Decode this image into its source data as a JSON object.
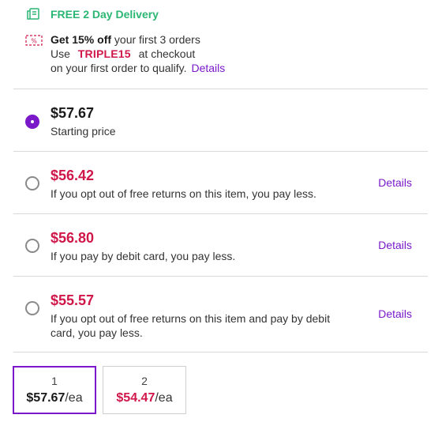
{
  "delivery": {
    "icon": "truck-icon",
    "label": "FREE 2 Day Delivery"
  },
  "promo": {
    "icon": "discount-tag-icon",
    "line1_bold": "Get 15% off",
    "line1_rest": " your first 3 orders",
    "line2_prefix": "Use",
    "code": "TRIPLE15",
    "line2_suffix": "at checkout",
    "line3": "on your first order to qualify.",
    "details_label": "Details"
  },
  "price_options": [
    {
      "price": "$57.67",
      "description": "Starting price",
      "selected": true
    },
    {
      "price": "$56.42",
      "description": "If you opt out of free returns on this item, you pay less.",
      "details_label": "Details",
      "selected": false
    },
    {
      "price": "$56.80",
      "description": "If you pay by debit card, you pay less.",
      "details_label": "Details",
      "selected": false
    },
    {
      "price": "$55.57",
      "description": "If you opt out of free returns on this item and pay by debit card, you pay less.",
      "details_label": "Details",
      "selected": false
    }
  ],
  "quantity_options": [
    {
      "qty": "1",
      "price": "$57.67",
      "unit": "/ea",
      "selected": true
    },
    {
      "qty": "2",
      "price": "$54.47",
      "unit": "/ea",
      "selected": false
    }
  ],
  "colors": {
    "accent": "#7a19c9",
    "discount": "#d0174a",
    "delivery": "#2bb673"
  }
}
